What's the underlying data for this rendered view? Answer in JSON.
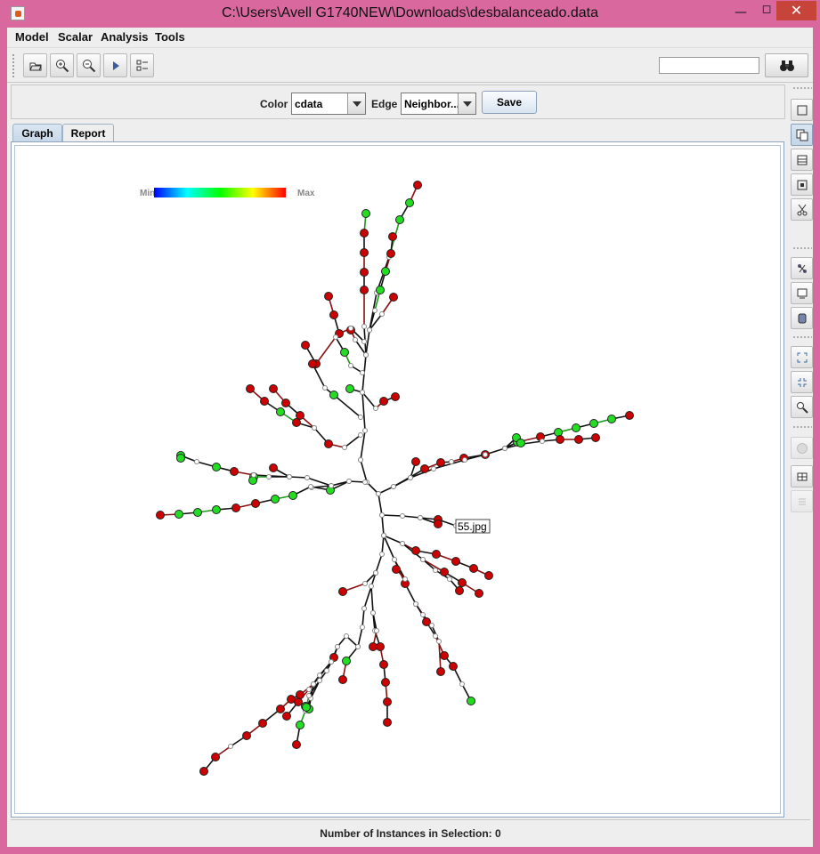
{
  "window": {
    "title": "C:\\Users\\Avell G1740NEW\\Downloads\\desbalanceado.data"
  },
  "menu": [
    "Model",
    "Scalar",
    "Analysis",
    "Tools"
  ],
  "controls": {
    "color_label": "Color",
    "color_value": "cdata",
    "edge_label": "Edge",
    "edge_value": "Neighbor...",
    "save_label": "Save"
  },
  "tabs": [
    "Graph",
    "Report"
  ],
  "legend": {
    "min": "Min",
    "max": "Max"
  },
  "tooltip": "55.jpg",
  "status": "Number of Instances in Selection: 0",
  "colors": {
    "accent": "#d9689f",
    "node_red": "#cc0000",
    "node_green": "#22dd22",
    "node_white": "#ffffff",
    "edge": "#111111"
  }
}
